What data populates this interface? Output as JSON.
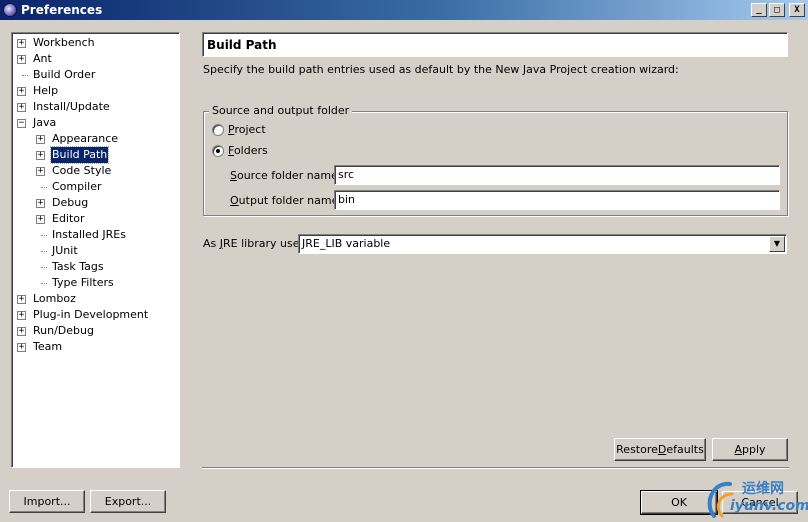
{
  "window": {
    "title": "Preferences",
    "minimize": "_",
    "maximize": "□",
    "close": "X"
  },
  "tree": {
    "items": [
      {
        "label": "Workbench",
        "expander": "+"
      },
      {
        "label": "Ant",
        "expander": "+"
      },
      {
        "label": "Build Order",
        "expander": ""
      },
      {
        "label": "Help",
        "expander": "+"
      },
      {
        "label": "Install/Update",
        "expander": "+"
      },
      {
        "label": "Java",
        "expander": "−"
      },
      {
        "label": "Appearance",
        "expander": "+"
      },
      {
        "label": "Build Path",
        "expander": "+",
        "selected": true
      },
      {
        "label": "Code Style",
        "expander": "+"
      },
      {
        "label": "Compiler",
        "expander": ""
      },
      {
        "label": "Debug",
        "expander": "+"
      },
      {
        "label": "Editor",
        "expander": "+"
      },
      {
        "label": "Installed JREs",
        "expander": ""
      },
      {
        "label": "JUnit",
        "expander": ""
      },
      {
        "label": "Task Tags",
        "expander": ""
      },
      {
        "label": "Type Filters",
        "expander": ""
      },
      {
        "label": "Lomboz",
        "expander": "+"
      },
      {
        "label": "Plug-in Development",
        "expander": "+"
      },
      {
        "label": "Run/Debug",
        "expander": "+"
      },
      {
        "label": "Team",
        "expander": "+"
      }
    ]
  },
  "page": {
    "title": "Build Path",
    "description": "Specify the build path entries used as default by the New Java Project creation wizard:",
    "source_group": {
      "title": "Source and output folder",
      "project_first": "P",
      "project_rest": "roject",
      "folders_first": "F",
      "folders_rest": "olders",
      "source_label_first": "S",
      "source_label_rest": "ource folder name:",
      "source_value": "src",
      "output_label_first": "O",
      "output_label_rest": "utput folder name:",
      "output_value": "bin"
    },
    "jre": {
      "label_before": "As ",
      "label_underlined": "J",
      "label_after": "RE library use:",
      "value": "JRE_LIB variable",
      "arrow": "▼"
    },
    "restore_before": "Restore ",
    "restore_underlined": "D",
    "restore_after": "efaults",
    "apply_first": "A",
    "apply_rest": "pply"
  },
  "footer": {
    "import": "Import...",
    "export": "Export...",
    "ok": "OK",
    "cancel": "Cancel"
  },
  "watermark": {
    "line1": "运维网",
    "line2": "iyunv.com"
  },
  "colors": {
    "selection": "#0a246a",
    "face": "#d4d0c8"
  }
}
